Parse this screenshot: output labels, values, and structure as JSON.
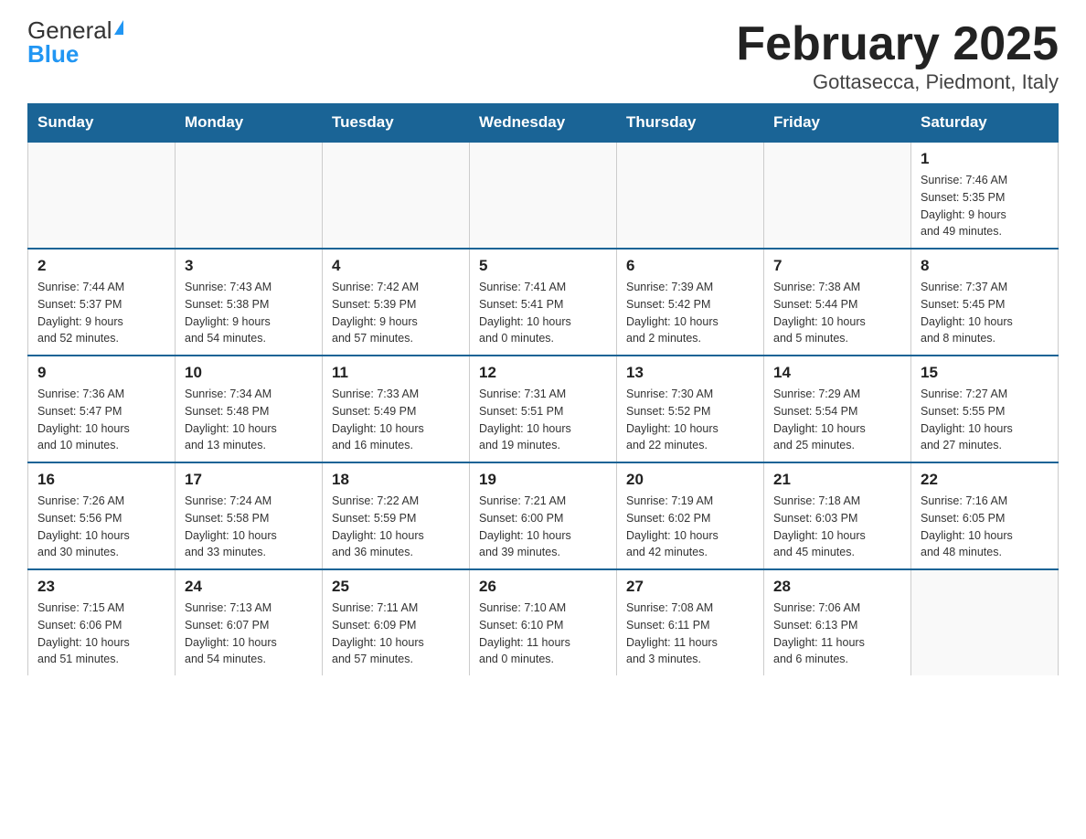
{
  "header": {
    "logo_general": "General",
    "logo_blue": "Blue",
    "title": "February 2025",
    "location": "Gottasecca, Piedmont, Italy"
  },
  "days_of_week": [
    "Sunday",
    "Monday",
    "Tuesday",
    "Wednesday",
    "Thursday",
    "Friday",
    "Saturday"
  ],
  "weeks": [
    [
      {
        "day": "",
        "info": ""
      },
      {
        "day": "",
        "info": ""
      },
      {
        "day": "",
        "info": ""
      },
      {
        "day": "",
        "info": ""
      },
      {
        "day": "",
        "info": ""
      },
      {
        "day": "",
        "info": ""
      },
      {
        "day": "1",
        "info": "Sunrise: 7:46 AM\nSunset: 5:35 PM\nDaylight: 9 hours\nand 49 minutes."
      }
    ],
    [
      {
        "day": "2",
        "info": "Sunrise: 7:44 AM\nSunset: 5:37 PM\nDaylight: 9 hours\nand 52 minutes."
      },
      {
        "day": "3",
        "info": "Sunrise: 7:43 AM\nSunset: 5:38 PM\nDaylight: 9 hours\nand 54 minutes."
      },
      {
        "day": "4",
        "info": "Sunrise: 7:42 AM\nSunset: 5:39 PM\nDaylight: 9 hours\nand 57 minutes."
      },
      {
        "day": "5",
        "info": "Sunrise: 7:41 AM\nSunset: 5:41 PM\nDaylight: 10 hours\nand 0 minutes."
      },
      {
        "day": "6",
        "info": "Sunrise: 7:39 AM\nSunset: 5:42 PM\nDaylight: 10 hours\nand 2 minutes."
      },
      {
        "day": "7",
        "info": "Sunrise: 7:38 AM\nSunset: 5:44 PM\nDaylight: 10 hours\nand 5 minutes."
      },
      {
        "day": "8",
        "info": "Sunrise: 7:37 AM\nSunset: 5:45 PM\nDaylight: 10 hours\nand 8 minutes."
      }
    ],
    [
      {
        "day": "9",
        "info": "Sunrise: 7:36 AM\nSunset: 5:47 PM\nDaylight: 10 hours\nand 10 minutes."
      },
      {
        "day": "10",
        "info": "Sunrise: 7:34 AM\nSunset: 5:48 PM\nDaylight: 10 hours\nand 13 minutes."
      },
      {
        "day": "11",
        "info": "Sunrise: 7:33 AM\nSunset: 5:49 PM\nDaylight: 10 hours\nand 16 minutes."
      },
      {
        "day": "12",
        "info": "Sunrise: 7:31 AM\nSunset: 5:51 PM\nDaylight: 10 hours\nand 19 minutes."
      },
      {
        "day": "13",
        "info": "Sunrise: 7:30 AM\nSunset: 5:52 PM\nDaylight: 10 hours\nand 22 minutes."
      },
      {
        "day": "14",
        "info": "Sunrise: 7:29 AM\nSunset: 5:54 PM\nDaylight: 10 hours\nand 25 minutes."
      },
      {
        "day": "15",
        "info": "Sunrise: 7:27 AM\nSunset: 5:55 PM\nDaylight: 10 hours\nand 27 minutes."
      }
    ],
    [
      {
        "day": "16",
        "info": "Sunrise: 7:26 AM\nSunset: 5:56 PM\nDaylight: 10 hours\nand 30 minutes."
      },
      {
        "day": "17",
        "info": "Sunrise: 7:24 AM\nSunset: 5:58 PM\nDaylight: 10 hours\nand 33 minutes."
      },
      {
        "day": "18",
        "info": "Sunrise: 7:22 AM\nSunset: 5:59 PM\nDaylight: 10 hours\nand 36 minutes."
      },
      {
        "day": "19",
        "info": "Sunrise: 7:21 AM\nSunset: 6:00 PM\nDaylight: 10 hours\nand 39 minutes."
      },
      {
        "day": "20",
        "info": "Sunrise: 7:19 AM\nSunset: 6:02 PM\nDaylight: 10 hours\nand 42 minutes."
      },
      {
        "day": "21",
        "info": "Sunrise: 7:18 AM\nSunset: 6:03 PM\nDaylight: 10 hours\nand 45 minutes."
      },
      {
        "day": "22",
        "info": "Sunrise: 7:16 AM\nSunset: 6:05 PM\nDaylight: 10 hours\nand 48 minutes."
      }
    ],
    [
      {
        "day": "23",
        "info": "Sunrise: 7:15 AM\nSunset: 6:06 PM\nDaylight: 10 hours\nand 51 minutes."
      },
      {
        "day": "24",
        "info": "Sunrise: 7:13 AM\nSunset: 6:07 PM\nDaylight: 10 hours\nand 54 minutes."
      },
      {
        "day": "25",
        "info": "Sunrise: 7:11 AM\nSunset: 6:09 PM\nDaylight: 10 hours\nand 57 minutes."
      },
      {
        "day": "26",
        "info": "Sunrise: 7:10 AM\nSunset: 6:10 PM\nDaylight: 11 hours\nand 0 minutes."
      },
      {
        "day": "27",
        "info": "Sunrise: 7:08 AM\nSunset: 6:11 PM\nDaylight: 11 hours\nand 3 minutes."
      },
      {
        "day": "28",
        "info": "Sunrise: 7:06 AM\nSunset: 6:13 PM\nDaylight: 11 hours\nand 6 minutes."
      },
      {
        "day": "",
        "info": ""
      }
    ]
  ]
}
